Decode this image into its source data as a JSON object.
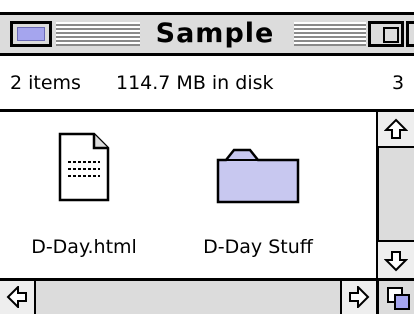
{
  "window": {
    "title": "Sample"
  },
  "header": {
    "item_count": "2 items",
    "disk_usage": "114.7 MB in disk",
    "available_partial": "3"
  },
  "items": [
    {
      "label": "D-Day.html",
      "icon": "html-document-icon"
    },
    {
      "label": "D-Day Stuff",
      "icon": "folder-icon"
    }
  ],
  "colors": {
    "titlebar": "#dcdcdc",
    "close_box_fill": "#a5a5ee",
    "folder_fill": "#c8c8f0",
    "scrollbar": "#dcdcdc"
  }
}
